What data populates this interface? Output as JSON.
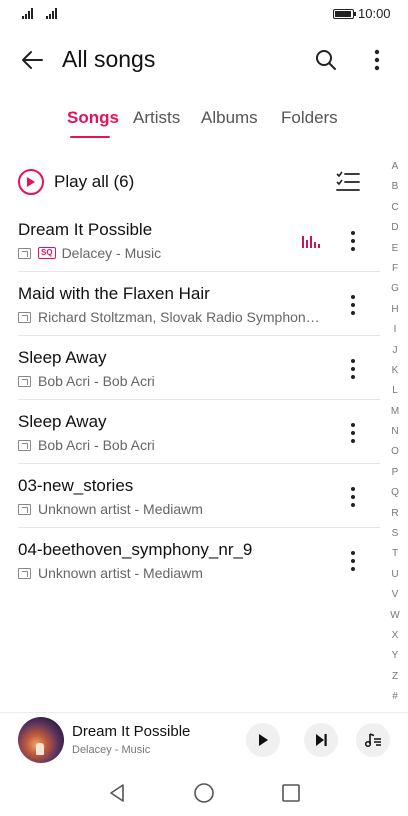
{
  "status": {
    "time": "10:00"
  },
  "header": {
    "title": "All songs",
    "icons": [
      "back-arrow-icon",
      "search-icon",
      "more-vertical-icon"
    ]
  },
  "tabs": [
    {
      "label": "Songs",
      "active": true
    },
    {
      "label": "Artists",
      "active": false
    },
    {
      "label": "Albums",
      "active": false
    },
    {
      "label": "Folders",
      "active": false
    }
  ],
  "play_all": {
    "label": "Play all (6)"
  },
  "songs": [
    {
      "title": "Dream It Possible",
      "subtitle": "Delacey - Music",
      "sq": "SQ",
      "playing": true
    },
    {
      "title": "Maid with the Flaxen Hair",
      "subtitle": "Richard Stoltzman, Slovak Radio Symphon…"
    },
    {
      "title": "Sleep Away",
      "subtitle": "Bob Acri - Bob Acri"
    },
    {
      "title": "Sleep Away",
      "subtitle": "Bob Acri - Bob Acri"
    },
    {
      "title": "03-new_stories",
      "subtitle": "Unknown artist - Mediawm"
    },
    {
      "title": "04-beethoven_symphony_nr_9",
      "subtitle": "Unknown artist - Mediawm"
    }
  ],
  "alphabet": [
    "A",
    "B",
    "C",
    "D",
    "E",
    "F",
    "G",
    "H",
    "I",
    "J",
    "K",
    "L",
    "M",
    "N",
    "O",
    "P",
    "Q",
    "R",
    "S",
    "T",
    "U",
    "V",
    "W",
    "X",
    "Y",
    "Z",
    "#"
  ],
  "now_playing": {
    "title": "Dream It Possible",
    "subtitle": "Delacey - Music"
  },
  "colors": {
    "accent": "#e8115b",
    "text": "#111111",
    "secondary": "#666666"
  }
}
